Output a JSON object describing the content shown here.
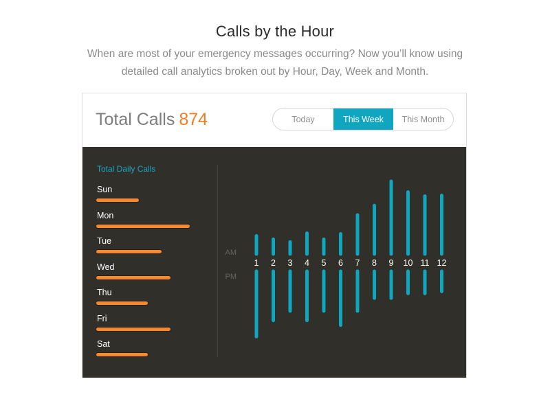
{
  "header": {
    "title": "Calls by the Hour",
    "subtitle": "When are most of your emergency messages occurring? Now you’ll know using detailed call analytics broken out by Hour, Day, Week and Month."
  },
  "card": {
    "total_label": "Total Calls",
    "total_value": "874",
    "tabs": [
      {
        "label": "Today",
        "active": false
      },
      {
        "label": "This Week",
        "active": true
      },
      {
        "label": "This Month",
        "active": false
      }
    ]
  },
  "colors": {
    "accent_teal": "#11a6bf",
    "accent_orange": "#f07d23",
    "bar_orange": "#f6882d",
    "panel_bg": "#302f2a"
  },
  "chart_data": [
    {
      "type": "bar",
      "orientation": "horizontal",
      "title": "Total Daily Calls",
      "categories": [
        "Sun",
        "Mon",
        "Tue",
        "Wed",
        "Thu",
        "Fri",
        "Sat"
      ],
      "values": [
        62,
        135,
        94,
        107,
        74,
        107,
        74
      ],
      "unit": "relative",
      "xlim": [
        0,
        135
      ]
    },
    {
      "type": "bar",
      "orientation": "vertical-diverging",
      "title": "Calls by the Hour",
      "categories": [
        "1",
        "2",
        "3",
        "4",
        "5",
        "6",
        "7",
        "8",
        "9",
        "10",
        "11",
        "12"
      ],
      "series": [
        {
          "name": "AM",
          "direction": "up",
          "values": [
            27,
            22,
            18,
            31,
            22,
            30,
            58,
            72,
            108,
            92,
            86,
            87
          ]
        },
        {
          "name": "PM",
          "direction": "down",
          "values": [
            97,
            73,
            59,
            73,
            59,
            80,
            59,
            40,
            40,
            33,
            33,
            30
          ]
        }
      ],
      "axis_labels": {
        "up": "AM",
        "down": "PM"
      },
      "ylim": [
        0,
        110
      ]
    }
  ]
}
